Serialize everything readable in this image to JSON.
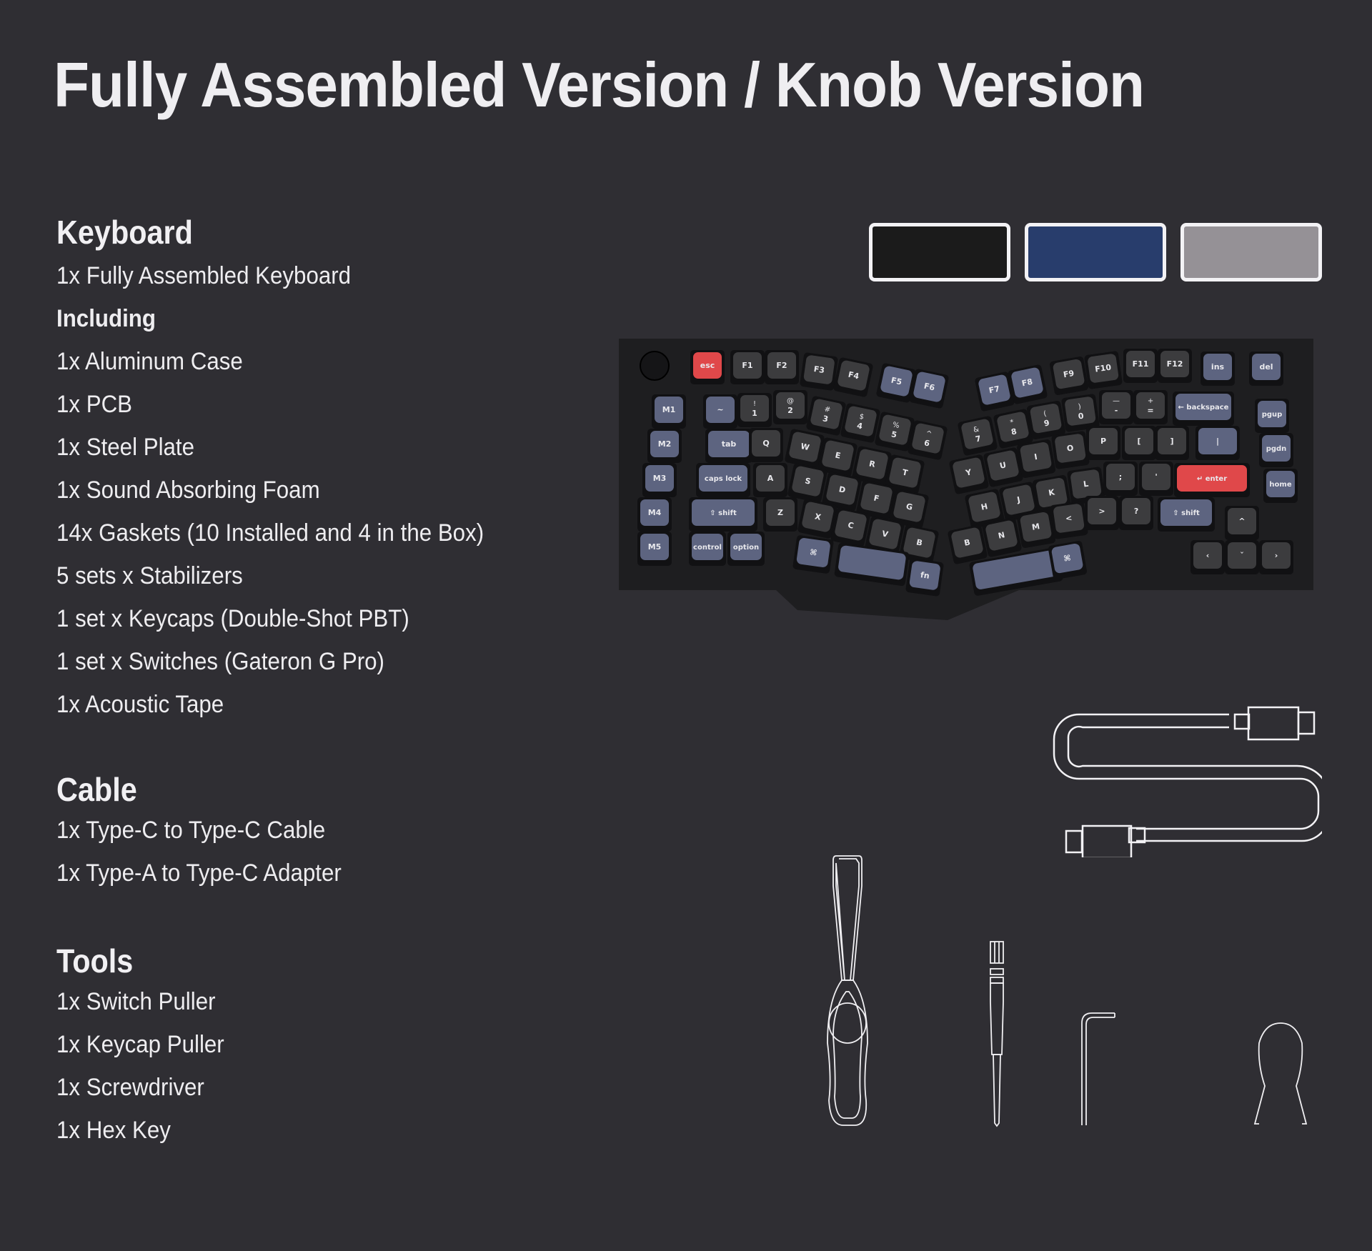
{
  "title": "Fully Assembled Version / Knob Version",
  "sections": {
    "keyboard": {
      "heading": "Keyboard",
      "items": [
        "1x Fully Assembled Keyboard"
      ],
      "subheading": "Including",
      "included": [
        "1x Aluminum Case",
        "1x PCB",
        "1x Steel Plate",
        "1x Sound Absorbing Foam",
        "14x Gaskets (10 Installed and 4 in the Box)",
        "5 sets x Stabilizers",
        "1 set x Keycaps (Double-Shot PBT)",
        "1 set x Switches (Gateron G Pro)",
        "1x Acoustic Tape"
      ]
    },
    "cable": {
      "heading": "Cable",
      "items": [
        "1x Type-C to Type-C Cable",
        "1x Type-A to Type-C Adapter"
      ]
    },
    "tools": {
      "heading": "Tools",
      "items": [
        "1x Switch Puller",
        "1x Keycap Puller",
        "1x Screwdriver",
        "1x Hex Key"
      ]
    }
  },
  "color_options": [
    {
      "name": "black",
      "color": "#1b1b1b"
    },
    {
      "name": "navy",
      "color": "#283d6c"
    },
    {
      "name": "gray",
      "color": "#959196"
    }
  ],
  "keyboard_colors": {
    "case": "#1e1e20",
    "dark_key": "#3c3c3e",
    "blue_key": "#5d6480",
    "accent_key": "#e0484a",
    "legend": "#e8e8ec"
  },
  "keyboard_legends": {
    "left": {
      "fn_row": [
        "esc",
        "F1",
        "F2",
        "F3",
        "F4",
        "F5",
        "F6"
      ],
      "macro": [
        "M1",
        "M2",
        "M3",
        "M4",
        "M5"
      ],
      "number_row": [
        "~",
        "1",
        "2",
        "3",
        "4",
        "5",
        "6"
      ],
      "number_shift": [
        "",
        "!",
        "@",
        "#",
        "$",
        "%",
        "^"
      ],
      "top_row": [
        "tab",
        "Q",
        "W",
        "E",
        "R",
        "T"
      ],
      "home_row": [
        "caps lock",
        "A",
        "S",
        "D",
        "F",
        "G"
      ],
      "bottom_row": [
        "⇧ shift",
        "Z",
        "X",
        "C",
        "V",
        "B"
      ],
      "mod_row": [
        "control",
        "option",
        "⌘",
        "",
        "fn"
      ]
    },
    "right": {
      "fn_row": [
        "F7",
        "F8",
        "F9",
        "F10",
        "F11",
        "F12",
        "ins",
        "del"
      ],
      "number_row": [
        "7",
        "8",
        "9",
        "0",
        "-",
        "=",
        "← backspace"
      ],
      "number_shift": [
        "&",
        "*",
        "(",
        ")",
        "—",
        "+",
        ""
      ],
      "top_row": [
        "Y",
        "U",
        "I",
        "O",
        "P",
        "[",
        "]",
        "|"
      ],
      "home_row": [
        "H",
        "J",
        "K",
        "L",
        ";",
        "'",
        "↵ enter"
      ],
      "bottom_row": [
        "B",
        "N",
        "M",
        "<",
        ">",
        "?",
        "⇧ shift"
      ],
      "mod_row": [
        "",
        "⌘"
      ],
      "nav": [
        "pgup",
        "pgdn",
        "home"
      ],
      "arrows": [
        "^",
        "‹",
        "ˇ",
        "›"
      ]
    }
  }
}
